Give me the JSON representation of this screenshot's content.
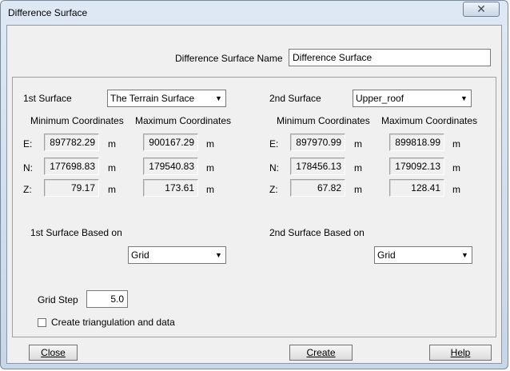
{
  "window": {
    "title": "Difference Surface",
    "close_glyph": "✕"
  },
  "name_field": {
    "label": "Difference Surface Name",
    "value": "Difference Surface"
  },
  "surface1": {
    "label": "1st  Surface",
    "selected": "The Terrain Surface",
    "min_header": "Minimum Coordinates",
    "max_header": "Maximum Coordinates",
    "e_label": "E:",
    "n_label": "N:",
    "z_label": "Z:",
    "e_min": "897782.29",
    "e_max": "900167.29",
    "n_min": "177698.83",
    "n_max": "179540.83",
    "z_min": "79.17",
    "z_max": "173.61",
    "unit": "m",
    "based_on_label": "1st Surface Based on",
    "based_on_value": "Grid"
  },
  "surface2": {
    "label": "2nd  Surface",
    "selected": "Upper_roof",
    "min_header": "Minimum  Coordinates",
    "max_header": "Maximum  Coordinates",
    "e_label": "E:",
    "n_label": "N:",
    "z_label": "Z:",
    "e_min": "897970.99",
    "e_max": "899818.99",
    "n_min": "178456.13",
    "n_max": "179092.13",
    "z_min": "67.82",
    "z_max": "128.41",
    "unit": "m",
    "based_on_label": "2nd Surface  Based on",
    "based_on_value": "Grid"
  },
  "grid_step": {
    "label": "Grid Step",
    "value": "5.0"
  },
  "triangulation": {
    "label": "Create triangulation and data"
  },
  "buttons": {
    "close": "Close",
    "create": "Create",
    "help": "Help"
  }
}
